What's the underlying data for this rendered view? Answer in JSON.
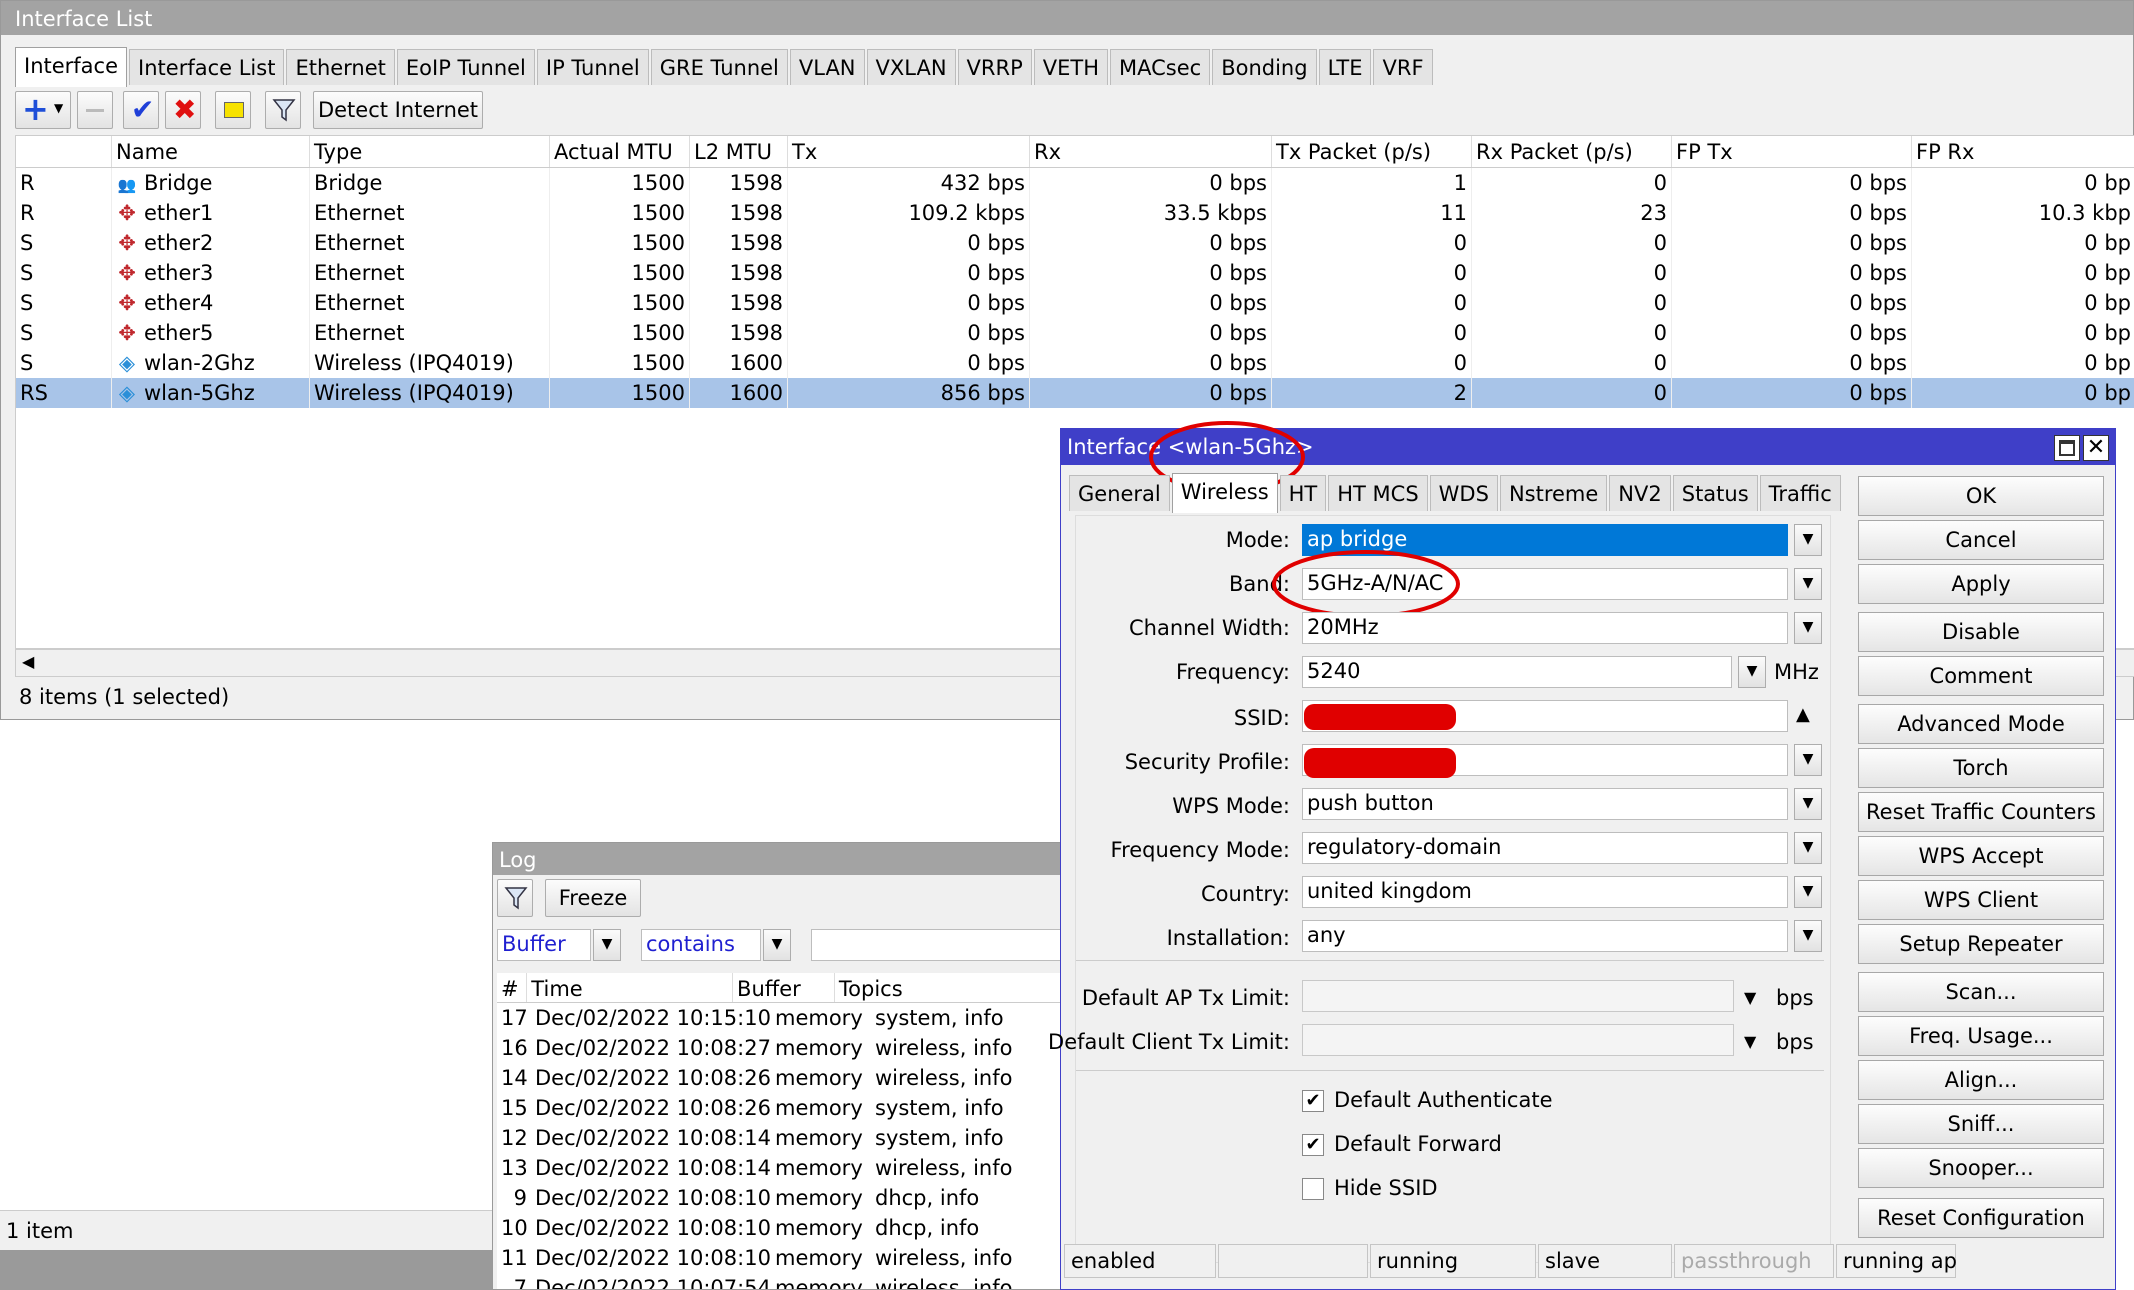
{
  "interface_list": {
    "title": "Interface List",
    "tabs": [
      "Interface",
      "Interface List",
      "Ethernet",
      "EoIP Tunnel",
      "IP Tunnel",
      "GRE Tunnel",
      "VLAN",
      "VXLAN",
      "VRRP",
      "VETH",
      "MACsec",
      "Bonding",
      "LTE",
      "VRF"
    ],
    "detect_internet": "Detect Internet",
    "columns": [
      "",
      "Name",
      "Type",
      "Actual MTU",
      "L2 MTU",
      "Tx",
      "Rx",
      "Tx Packet (p/s)",
      "Rx Packet (p/s)",
      "FP Tx",
      "FP Rx"
    ],
    "rows": [
      {
        "flag": "R",
        "name": "Bridge",
        "icon": "bridge-icon",
        "type": "Bridge",
        "mtu": "1500",
        "l2mtu": "1598",
        "tx": "432 bps",
        "rx": "0 bps",
        "txp": "1",
        "rxp": "0",
        "fptx": "0 bps",
        "fprx": "0 bp"
      },
      {
        "flag": "R",
        "name": "ether1",
        "icon": "ethernet-icon",
        "type": "Ethernet",
        "mtu": "1500",
        "l2mtu": "1598",
        "tx": "109.2 kbps",
        "rx": "33.5 kbps",
        "txp": "11",
        "rxp": "23",
        "fptx": "0 bps",
        "fprx": "10.3 kbp"
      },
      {
        "flag": "S",
        "name": "ether2",
        "icon": "ethernet-icon",
        "type": "Ethernet",
        "mtu": "1500",
        "l2mtu": "1598",
        "tx": "0 bps",
        "rx": "0 bps",
        "txp": "0",
        "rxp": "0",
        "fptx": "0 bps",
        "fprx": "0 bp"
      },
      {
        "flag": "S",
        "name": "ether3",
        "icon": "ethernet-icon",
        "type": "Ethernet",
        "mtu": "1500",
        "l2mtu": "1598",
        "tx": "0 bps",
        "rx": "0 bps",
        "txp": "0",
        "rxp": "0",
        "fptx": "0 bps",
        "fprx": "0 bp"
      },
      {
        "flag": "S",
        "name": "ether4",
        "icon": "ethernet-icon",
        "type": "Ethernet",
        "mtu": "1500",
        "l2mtu": "1598",
        "tx": "0 bps",
        "rx": "0 bps",
        "txp": "0",
        "rxp": "0",
        "fptx": "0 bps",
        "fprx": "0 bp"
      },
      {
        "flag": "S",
        "name": "ether5",
        "icon": "ethernet-icon",
        "type": "Ethernet",
        "mtu": "1500",
        "l2mtu": "1598",
        "tx": "0 bps",
        "rx": "0 bps",
        "txp": "0",
        "rxp": "0",
        "fptx": "0 bps",
        "fprx": "0 bp"
      },
      {
        "flag": "S",
        "name": "wlan-2Ghz",
        "icon": "wireless-icon",
        "type": "Wireless (IPQ4019)",
        "mtu": "1500",
        "l2mtu": "1600",
        "tx": "0 bps",
        "rx": "0 bps",
        "txp": "0",
        "rxp": "0",
        "fptx": "0 bps",
        "fprx": "0 bp"
      },
      {
        "flag": "RS",
        "name": "wlan-5Ghz",
        "icon": "wireless-icon",
        "type": "Wireless (IPQ4019)",
        "mtu": "1500",
        "l2mtu": "1600",
        "tx": "856 bps",
        "rx": "0 bps",
        "txp": "2",
        "rxp": "0",
        "fptx": "0 bps",
        "fprx": "0 bp",
        "selected": true
      }
    ],
    "status": "8 items (1 selected)"
  },
  "bottom_status": "1 item",
  "log": {
    "title": "Log",
    "freeze": "Freeze",
    "filter_field": "Buffer",
    "filter_op": "contains",
    "filter_value": "",
    "columns": [
      "#",
      "Time",
      "Buffer",
      "Topics"
    ],
    "rows": [
      {
        "n": "17",
        "time": "Dec/02/2022 10:15:10",
        "buffer": "memory",
        "topics": "system, info"
      },
      {
        "n": "16",
        "time": "Dec/02/2022 10:08:27",
        "buffer": "memory",
        "topics": "wireless, info"
      },
      {
        "n": "14",
        "time": "Dec/02/2022 10:08:26",
        "buffer": "memory",
        "topics": "wireless, info"
      },
      {
        "n": "15",
        "time": "Dec/02/2022 10:08:26",
        "buffer": "memory",
        "topics": "system, info"
      },
      {
        "n": "12",
        "time": "Dec/02/2022 10:08:14",
        "buffer": "memory",
        "topics": "system, info"
      },
      {
        "n": "13",
        "time": "Dec/02/2022 10:08:14",
        "buffer": "memory",
        "topics": "wireless, info"
      },
      {
        "n": "9",
        "time": "Dec/02/2022 10:08:10",
        "buffer": "memory",
        "topics": "dhcp, info"
      },
      {
        "n": "10",
        "time": "Dec/02/2022 10:08:10",
        "buffer": "memory",
        "topics": "dhcp, info"
      },
      {
        "n": "11",
        "time": "Dec/02/2022 10:08:10",
        "buffer": "memory",
        "topics": "wireless, info"
      },
      {
        "n": "7",
        "time": "Dec/02/2022 10:07:54",
        "buffer": "memory",
        "topics": "wireless, info"
      }
    ]
  },
  "dialog": {
    "title": "Interface <wlan-5Ghz>",
    "tabs": [
      "General",
      "Wireless",
      "HT",
      "HT MCS",
      "WDS",
      "Nstreme",
      "NV2",
      "Status",
      "Traffic"
    ],
    "fields": {
      "mode": {
        "label": "Mode:",
        "value": "ap bridge"
      },
      "band": {
        "label": "Band:",
        "value": "5GHz-A/N/AC"
      },
      "channel_width": {
        "label": "Channel Width:",
        "value": "20MHz"
      },
      "frequency": {
        "label": "Frequency:",
        "value": "5240",
        "unit": "MHz"
      },
      "ssid": {
        "label": "SSID:"
      },
      "security_profile": {
        "label": "Security Profile:"
      },
      "wps_mode": {
        "label": "WPS Mode:",
        "value": "push button"
      },
      "frequency_mode": {
        "label": "Frequency Mode:",
        "value": "regulatory-domain"
      },
      "country": {
        "label": "Country:",
        "value": "united kingdom"
      },
      "installation": {
        "label": "Installation:",
        "value": "any"
      },
      "ap_tx_limit": {
        "label": "Default AP Tx Limit:",
        "unit": "bps"
      },
      "client_tx_limit": {
        "label": "Default Client Tx Limit:",
        "unit": "bps"
      }
    },
    "checks": {
      "default_authenticate": {
        "label": "Default Authenticate",
        "checked": true
      },
      "default_forward": {
        "label": "Default Forward",
        "checked": true
      },
      "hide_ssid": {
        "label": "Hide SSID",
        "checked": false
      }
    },
    "buttons": [
      "OK",
      "Cancel",
      "Apply",
      "Disable",
      "Comment",
      "Advanced Mode",
      "Torch",
      "Reset Traffic Counters",
      "WPS Accept",
      "WPS Client",
      "Setup Repeater",
      "Scan...",
      "Freq. Usage...",
      "Align...",
      "Sniff...",
      "Snooper...",
      "Reset Configuration"
    ],
    "status": [
      "enabled",
      "",
      "running",
      "slave",
      "passthrough",
      "running ap"
    ]
  },
  "colors": {
    "accent": "#3f3fc8",
    "selected_row": "#a8c4e8",
    "field_highlight": "#0078d7",
    "annotation": "#e00000"
  }
}
